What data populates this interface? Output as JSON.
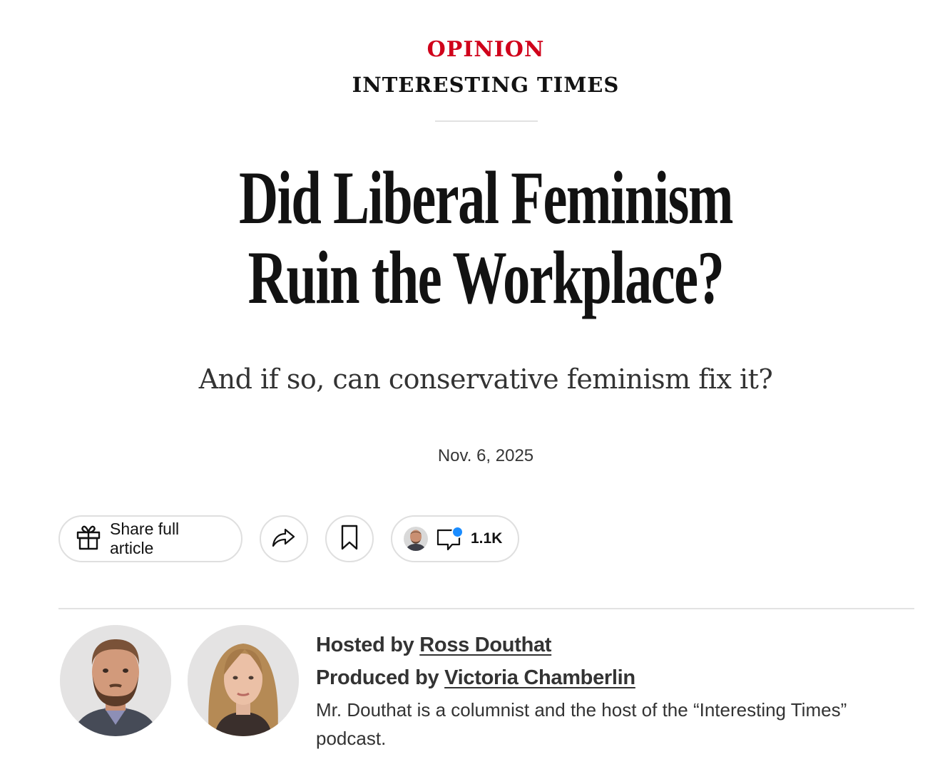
{
  "header": {
    "section": "OPINION",
    "series": "INTERESTING TIMES"
  },
  "article": {
    "headline_line1": "Did Liberal Feminism",
    "headline_line2": "Ruin the Workplace?",
    "subheadline": "And if so, can conservative feminism fix it?",
    "date": "Nov. 6, 2025"
  },
  "toolbar": {
    "share_full_label": "Share full article",
    "comment_count": "1.1K",
    "icons": {
      "gift": "gift-icon",
      "share": "share-arrow-icon",
      "save": "bookmark-icon",
      "comments": "comment-bubble-icon"
    },
    "notification_color": "#1a8cff"
  },
  "credits": {
    "hosted_prefix": "Hosted by",
    "host_name": "Ross Douthat",
    "produced_prefix": "Produced by",
    "producer_name": "Victoria Chamberlin",
    "bio": "Mr. Douthat is a columnist and the host of the “Interesting Times” podcast."
  },
  "colors": {
    "accent": "#d0021b",
    "text": "#121212",
    "muted": "#333333",
    "border": "#dfdfdf"
  }
}
